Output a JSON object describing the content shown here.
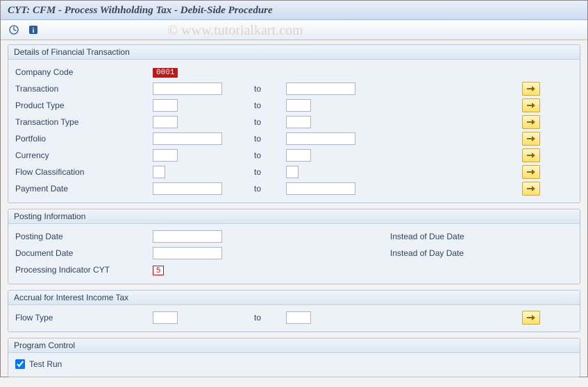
{
  "title": "CYT: CFM - Process Withholding Tax - Debit-Side Procedure",
  "watermark": "© www.tutorialkart.com",
  "toolbar": {
    "execute_icon": "execute-icon",
    "info_icon": "info-icon"
  },
  "groups": {
    "details": {
      "title": "Details of Financial Transaction",
      "company_code_label": "Company Code",
      "company_code_value": "0001",
      "to_label": "to",
      "rows": [
        {
          "label": "Transaction",
          "from": "",
          "to": "",
          "size": "w100"
        },
        {
          "label": "Product Type",
          "from": "",
          "to": "",
          "size": "w36"
        },
        {
          "label": "Transaction Type",
          "from": "",
          "to": "",
          "size": "w36"
        },
        {
          "label": "Portfolio",
          "from": "",
          "to": "",
          "size": "w100"
        },
        {
          "label": "Currency",
          "from": "",
          "to": "",
          "size": "w36"
        },
        {
          "label": "Flow Classification",
          "from": "",
          "to": "",
          "size": "w20"
        },
        {
          "label": "Payment Date",
          "from": "",
          "to": "",
          "size": "w100"
        }
      ]
    },
    "posting": {
      "title": "Posting Information",
      "posting_date_label": "Posting Date",
      "posting_date_value": "",
      "posting_date_note": "Instead of Due Date",
      "document_date_label": "Document Date",
      "document_date_value": "",
      "document_date_note": "Instead of Day Date",
      "indicator_label": "Processing Indicator CYT",
      "indicator_value": "5"
    },
    "accrual": {
      "title": "Accrual for Interest Income Tax",
      "flow_type_label": "Flow Type",
      "flow_type_from": "",
      "flow_type_to": "",
      "to_label": "to"
    },
    "control": {
      "title": "Program Control",
      "test_run_label": "Test Run",
      "test_run_checked": true
    }
  }
}
